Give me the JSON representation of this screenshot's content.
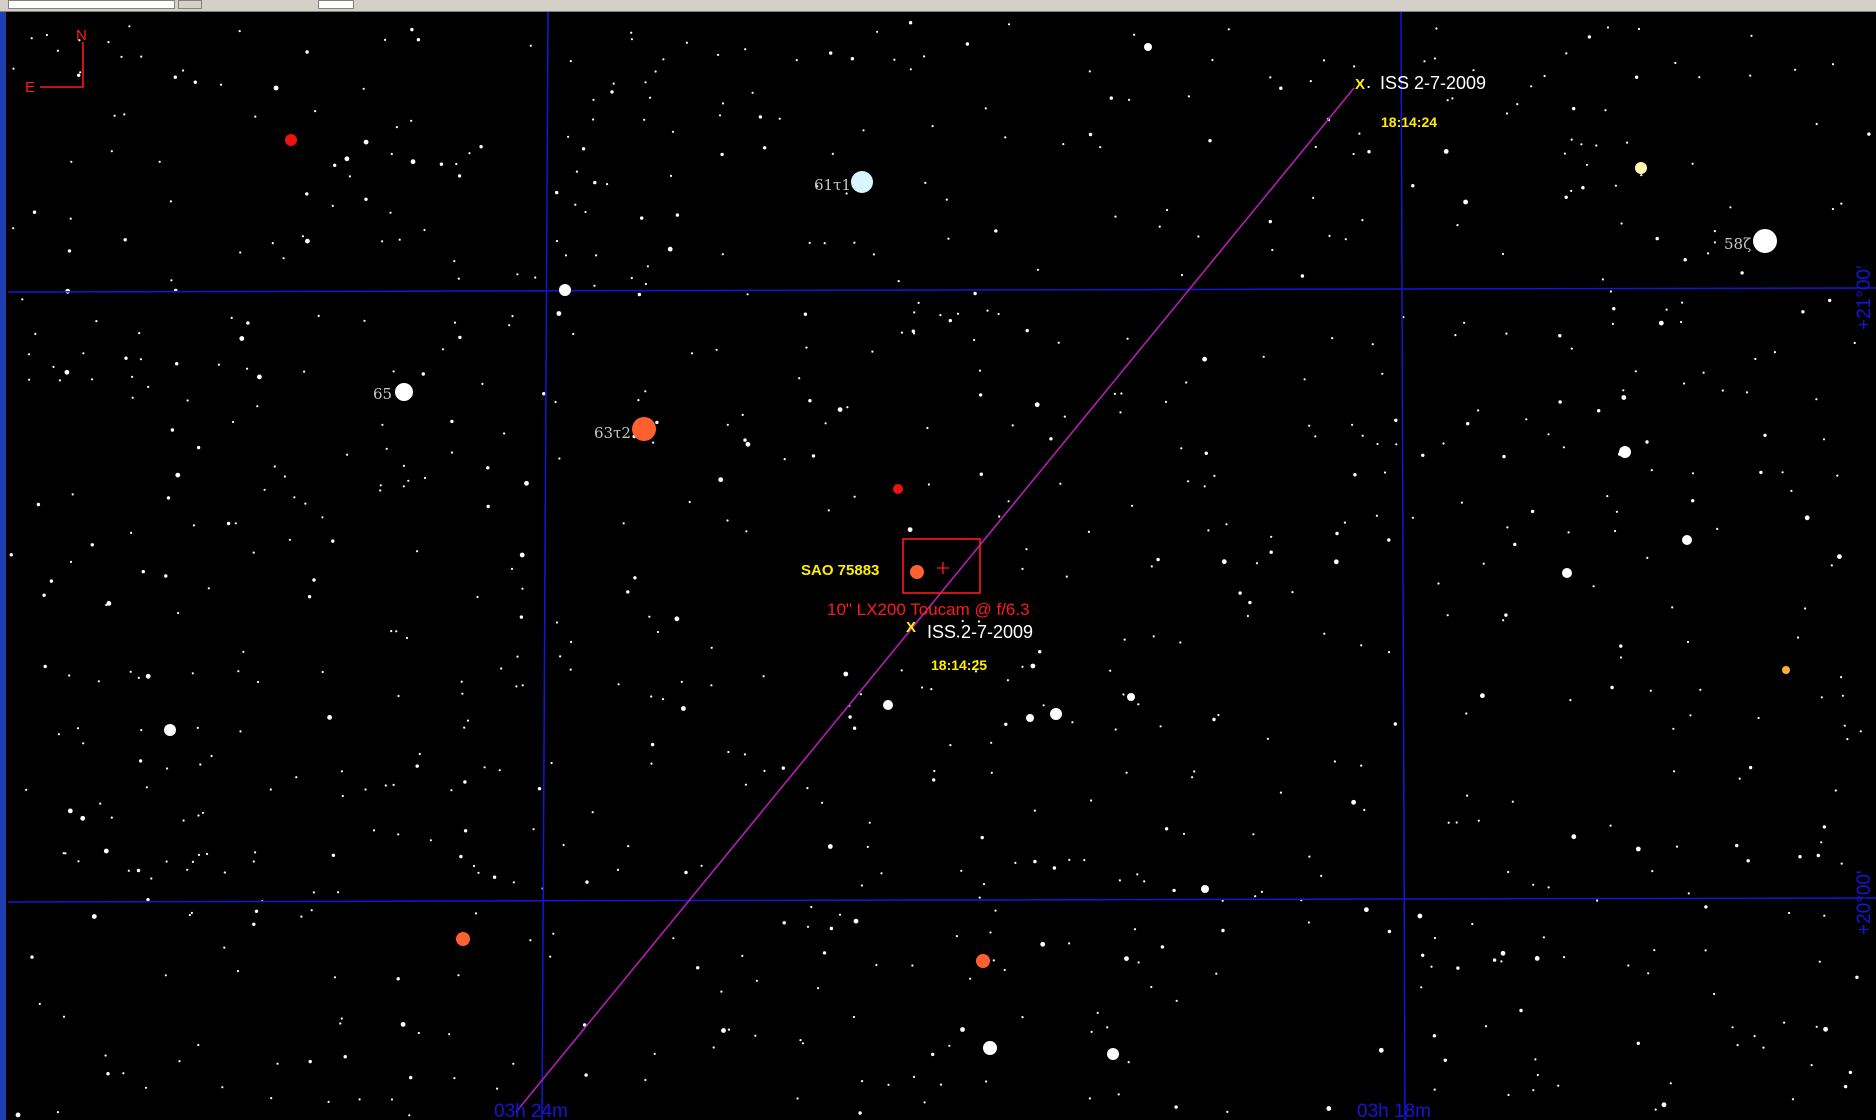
{
  "compass": {
    "north": "N",
    "east": "E"
  },
  "grid": {
    "ra_labels": [
      "03h 24m",
      "03h 18m"
    ],
    "dec_labels": [
      "+21°00'",
      "+20°00'"
    ]
  },
  "named_stars": [
    {
      "label": "61τ1"
    },
    {
      "label": "58ζ"
    },
    {
      "label": "65"
    },
    {
      "label": "63τ2"
    }
  ],
  "target": {
    "star_label": "SAO 75883",
    "fov_label": "10\" LX200 Toucam @ f/6.3"
  },
  "iss_marks": [
    {
      "marker": "X",
      "name": "ISS 2-7-2009",
      "time": "18:14:24"
    },
    {
      "marker": "X",
      "name": "ISS 2-7-2009",
      "time": "18:14:25"
    }
  ],
  "colors": {
    "background": "#000000",
    "grid": "#1515d8",
    "track": "#b21fb5",
    "fov": "#ff1a1a",
    "label_yellow": "#ffee00",
    "compass": "#ff1a1a"
  }
}
